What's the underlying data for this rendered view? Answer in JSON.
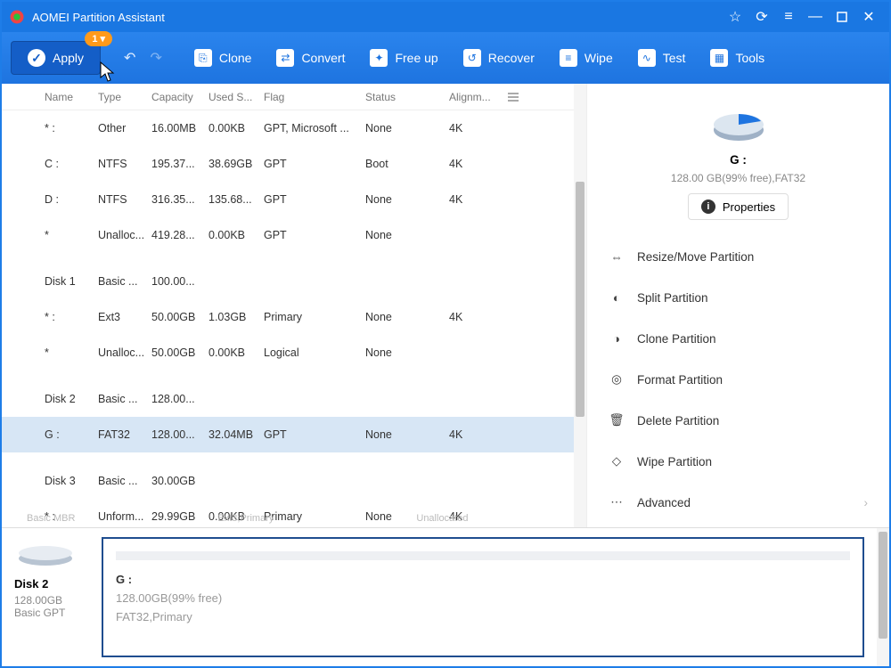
{
  "titlebar": {
    "title": "AOMEI Partition Assistant"
  },
  "toolbar": {
    "apply": "Apply",
    "pending": "1 ▾",
    "items": [
      "Clone",
      "Convert",
      "Free up",
      "Recover",
      "Wipe",
      "Test",
      "Tools"
    ]
  },
  "columns": [
    "Name",
    "Type",
    "Capacity",
    "Used S...",
    "Flag",
    "Status",
    "Alignm..."
  ],
  "rows": [
    {
      "kind": "part",
      "name": "* :",
      "type": "Other",
      "cap": "16.00MB",
      "used": "0.00KB",
      "flag": "GPT, Microsoft ...",
      "status": "None",
      "align": "4K"
    },
    {
      "kind": "part",
      "name": "C :",
      "type": "NTFS",
      "cap": "195.37...",
      "used": "38.69GB",
      "flag": "GPT",
      "status": "Boot",
      "align": "4K"
    },
    {
      "kind": "part",
      "name": "D :",
      "type": "NTFS",
      "cap": "316.35...",
      "used": "135.68...",
      "flag": "GPT",
      "status": "None",
      "align": "4K"
    },
    {
      "kind": "part",
      "name": "*",
      "type": "Unalloc...",
      "cap": "419.28...",
      "used": "0.00KB",
      "flag": "GPT",
      "status": "None",
      "align": ""
    },
    {
      "kind": "disk",
      "name": "Disk 1",
      "type": "Basic ...",
      "cap": "100.00..."
    },
    {
      "kind": "part",
      "name": "* :",
      "type": "Ext3",
      "cap": "50.00GB",
      "used": "1.03GB",
      "flag": "Primary",
      "status": "None",
      "align": "4K"
    },
    {
      "kind": "part",
      "name": "*",
      "type": "Unalloc...",
      "cap": "50.00GB",
      "used": "0.00KB",
      "flag": "Logical",
      "status": "None",
      "align": ""
    },
    {
      "kind": "disk",
      "name": "Disk 2",
      "type": "Basic ...",
      "cap": "128.00..."
    },
    {
      "kind": "part",
      "sel": true,
      "name": "G :",
      "type": "FAT32",
      "cap": "128.00...",
      "used": "32.04MB",
      "flag": "GPT",
      "status": "None",
      "align": "4K"
    },
    {
      "kind": "disk",
      "name": "Disk 3",
      "type": "Basic ...",
      "cap": "30.00GB"
    },
    {
      "kind": "part",
      "name": "* :",
      "type": "Unform...",
      "cap": "29.99GB",
      "used": "0.00KB",
      "flag": "Primary",
      "status": "None",
      "align": "4K"
    }
  ],
  "crumbs": {
    "a": "Basic MBR",
    "b": "Ext3;Primary",
    "c": "Unallocated"
  },
  "side": {
    "drive": "G :",
    "sub": "128.00 GB(99% free),FAT32",
    "props": "Properties",
    "ops": [
      "Resize/Move Partition",
      "Split Partition",
      "Clone Partition",
      "Format Partition",
      "Delete Partition",
      "Wipe Partition"
    ],
    "advanced": "Advanced"
  },
  "bottom": {
    "disk": "Disk 2",
    "size": "128.00GB",
    "scheme": "Basic GPT",
    "partlabel": "G :",
    "freeln": "128.00GB(99% free)",
    "fsln": "FAT32,Primary"
  }
}
